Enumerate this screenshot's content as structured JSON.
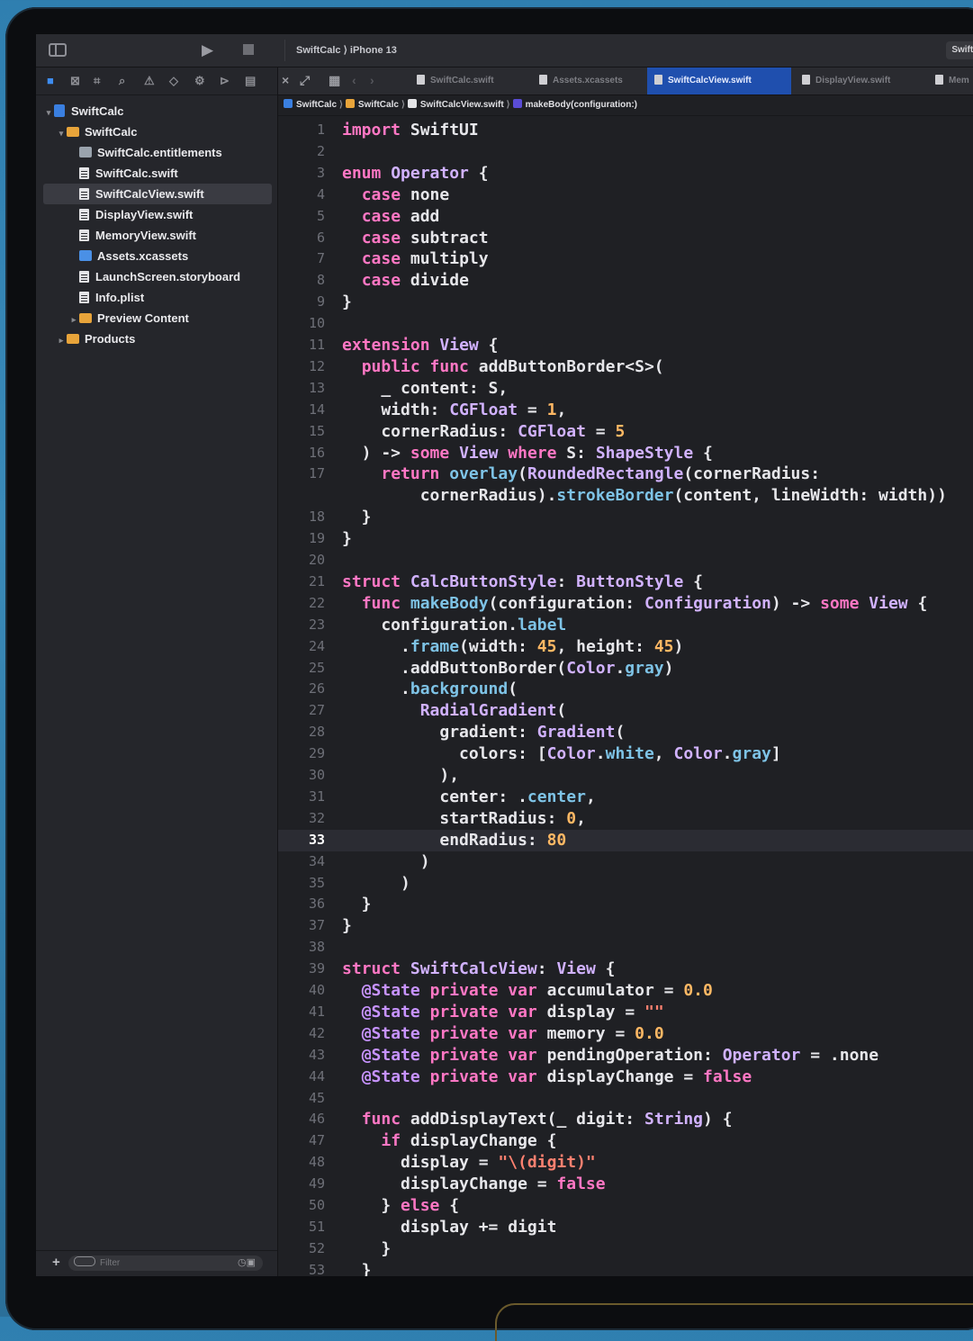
{
  "toolbar": {
    "scheme": "SwiftCalc ⟩ iPhone 13",
    "scheme_right": "SwiftCa",
    "run_icon": "play-icon",
    "stop_icon": "stop-icon"
  },
  "navigator": {
    "filter_placeholder": "Filter",
    "items": [
      {
        "label": "SwiftCalc",
        "kind": "project",
        "depth": 0,
        "disclosure": "▾"
      },
      {
        "label": "SwiftCalc",
        "kind": "folder",
        "depth": 1,
        "disclosure": "▾"
      },
      {
        "label": "SwiftCalc.entitlements",
        "kind": "entitlements",
        "depth": 2,
        "disclosure": ""
      },
      {
        "label": "SwiftCalc.swift",
        "kind": "file",
        "depth": 2,
        "disclosure": ""
      },
      {
        "label": "SwiftCalcView.swift",
        "kind": "file",
        "depth": 2,
        "disclosure": "",
        "selected": true
      },
      {
        "label": "DisplayView.swift",
        "kind": "file",
        "depth": 2,
        "disclosure": ""
      },
      {
        "label": "MemoryView.swift",
        "kind": "file",
        "depth": 2,
        "disclosure": ""
      },
      {
        "label": "Assets.xcassets",
        "kind": "assets",
        "depth": 2,
        "disclosure": ""
      },
      {
        "label": "LaunchScreen.storyboard",
        "kind": "file",
        "depth": 2,
        "disclosure": ""
      },
      {
        "label": "Info.plist",
        "kind": "file",
        "depth": 2,
        "disclosure": ""
      },
      {
        "label": "Preview Content",
        "kind": "folder",
        "depth": 2,
        "disclosure": "▸"
      },
      {
        "label": "Products",
        "kind": "folder",
        "depth": 1,
        "disclosure": "▸"
      }
    ]
  },
  "tabs": [
    {
      "label": "SwiftCalc.swift",
      "active": false
    },
    {
      "label": "Assets.xcassets",
      "active": false
    },
    {
      "label": "SwiftCalcView.swift",
      "active": true
    },
    {
      "label": "DisplayView.swift",
      "active": false
    },
    {
      "label": "Mem",
      "active": false
    }
  ],
  "jumpbar": {
    "project": "SwiftCalc",
    "folder": "SwiftCalc",
    "file": "SwiftCalcView.swift",
    "symbol": "makeBody(configuration:)"
  },
  "editor": {
    "current_line": 33,
    "lines": [
      {
        "n": "1",
        "tokens": [
          [
            "kw",
            "import"
          ],
          [
            "pl",
            " SwiftUI"
          ]
        ]
      },
      {
        "n": "2",
        "tokens": []
      },
      {
        "n": "3",
        "tokens": [
          [
            "kw",
            "enum"
          ],
          [
            "pl",
            " "
          ],
          [
            "ty",
            "Operator"
          ],
          [
            "pl",
            " {"
          ]
        ]
      },
      {
        "n": "4",
        "tokens": [
          [
            "pl",
            "  "
          ],
          [
            "kw",
            "case"
          ],
          [
            "pl",
            " none"
          ]
        ]
      },
      {
        "n": "5",
        "tokens": [
          [
            "pl",
            "  "
          ],
          [
            "kw",
            "case"
          ],
          [
            "pl",
            " add"
          ]
        ]
      },
      {
        "n": "6",
        "tokens": [
          [
            "pl",
            "  "
          ],
          [
            "kw",
            "case"
          ],
          [
            "pl",
            " subtract"
          ]
        ]
      },
      {
        "n": "7",
        "tokens": [
          [
            "pl",
            "  "
          ],
          [
            "kw",
            "case"
          ],
          [
            "pl",
            " multiply"
          ]
        ]
      },
      {
        "n": "8",
        "tokens": [
          [
            "pl",
            "  "
          ],
          [
            "kw",
            "case"
          ],
          [
            "pl",
            " divide"
          ]
        ]
      },
      {
        "n": "9",
        "tokens": [
          [
            "pl",
            "}"
          ]
        ]
      },
      {
        "n": "10",
        "tokens": []
      },
      {
        "n": "11",
        "tokens": [
          [
            "kw",
            "extension"
          ],
          [
            "pl",
            " "
          ],
          [
            "ty",
            "View"
          ],
          [
            "pl",
            " {"
          ]
        ]
      },
      {
        "n": "12",
        "tokens": [
          [
            "pl",
            "  "
          ],
          [
            "kw",
            "public func"
          ],
          [
            "pl",
            " addButtonBorder<S>("
          ]
        ]
      },
      {
        "n": "13",
        "tokens": [
          [
            "pl",
            "    _ content: S,"
          ]
        ]
      },
      {
        "n": "14",
        "tokens": [
          [
            "pl",
            "    width: "
          ],
          [
            "ty",
            "CGFloat"
          ],
          [
            "pl",
            " = "
          ],
          [
            "nb",
            "1"
          ],
          [
            "pl",
            ","
          ]
        ]
      },
      {
        "n": "15",
        "tokens": [
          [
            "pl",
            "    cornerRadius: "
          ],
          [
            "ty",
            "CGFloat"
          ],
          [
            "pl",
            " = "
          ],
          [
            "nb",
            "5"
          ]
        ]
      },
      {
        "n": "16",
        "tokens": [
          [
            "pl",
            "  ) -> "
          ],
          [
            "kw",
            "some"
          ],
          [
            "pl",
            " "
          ],
          [
            "ty",
            "View"
          ],
          [
            "pl",
            " "
          ],
          [
            "kw",
            "where"
          ],
          [
            "pl",
            " S: "
          ],
          [
            "ty",
            "ShapeStyle"
          ],
          [
            "pl",
            " {"
          ]
        ]
      },
      {
        "n": "17",
        "tokens": [
          [
            "pl",
            "    "
          ],
          [
            "kw",
            "return"
          ],
          [
            "pl",
            " "
          ],
          [
            "fn",
            "overlay"
          ],
          [
            "pl",
            "("
          ],
          [
            "ty",
            "RoundedRectangle"
          ],
          [
            "pl",
            "(cornerRadius:"
          ]
        ]
      },
      {
        "n": "",
        "tokens": [
          [
            "pl",
            "        cornerRadius)."
          ],
          [
            "fn",
            "strokeBorder"
          ],
          [
            "pl",
            "(content, lineWidth: width))"
          ]
        ]
      },
      {
        "n": "18",
        "tokens": [
          [
            "pl",
            "  }"
          ]
        ]
      },
      {
        "n": "19",
        "tokens": [
          [
            "pl",
            "}"
          ]
        ]
      },
      {
        "n": "20",
        "tokens": []
      },
      {
        "n": "21",
        "tokens": [
          [
            "kw",
            "struct"
          ],
          [
            "pl",
            " "
          ],
          [
            "ty",
            "CalcButtonStyle"
          ],
          [
            "pl",
            ": "
          ],
          [
            "ty",
            "ButtonStyle"
          ],
          [
            "pl",
            " {"
          ]
        ]
      },
      {
        "n": "22",
        "tokens": [
          [
            "pl",
            "  "
          ],
          [
            "kw",
            "func"
          ],
          [
            "pl",
            " "
          ],
          [
            "fn",
            "makeBody"
          ],
          [
            "pl",
            "(configuration: "
          ],
          [
            "ty",
            "Configuration"
          ],
          [
            "pl",
            ") -> "
          ],
          [
            "kw",
            "some"
          ],
          [
            "pl",
            " "
          ],
          [
            "ty",
            "View"
          ],
          [
            "pl",
            " {"
          ]
        ]
      },
      {
        "n": "23",
        "tokens": [
          [
            "pl",
            "    configuration."
          ],
          [
            "fn",
            "label"
          ]
        ]
      },
      {
        "n": "24",
        "tokens": [
          [
            "pl",
            "      ."
          ],
          [
            "fn",
            "frame"
          ],
          [
            "pl",
            "(width: "
          ],
          [
            "nb",
            "45"
          ],
          [
            "pl",
            ", height: "
          ],
          [
            "nb",
            "45"
          ],
          [
            "pl",
            ")"
          ]
        ]
      },
      {
        "n": "25",
        "tokens": [
          [
            "pl",
            "      .addButtonBorder("
          ],
          [
            "ty",
            "Color"
          ],
          [
            "pl",
            "."
          ],
          [
            "fn",
            "gray"
          ],
          [
            "pl",
            ")"
          ]
        ]
      },
      {
        "n": "26",
        "tokens": [
          [
            "pl",
            "      ."
          ],
          [
            "fn",
            "background"
          ],
          [
            "pl",
            "("
          ]
        ]
      },
      {
        "n": "27",
        "tokens": [
          [
            "pl",
            "        "
          ],
          [
            "ty",
            "RadialGradient"
          ],
          [
            "pl",
            "("
          ]
        ]
      },
      {
        "n": "28",
        "tokens": [
          [
            "pl",
            "          gradient: "
          ],
          [
            "ty",
            "Gradient"
          ],
          [
            "pl",
            "("
          ]
        ]
      },
      {
        "n": "29",
        "tokens": [
          [
            "pl",
            "            colors: ["
          ],
          [
            "ty",
            "Color"
          ],
          [
            "pl",
            "."
          ],
          [
            "fn",
            "white"
          ],
          [
            "pl",
            ", "
          ],
          [
            "ty",
            "Color"
          ],
          [
            "pl",
            "."
          ],
          [
            "fn",
            "gray"
          ],
          [
            "pl",
            "]"
          ]
        ]
      },
      {
        "n": "30",
        "tokens": [
          [
            "pl",
            "          ),"
          ]
        ]
      },
      {
        "n": "31",
        "tokens": [
          [
            "pl",
            "          center: ."
          ],
          [
            "fn",
            "center"
          ],
          [
            "pl",
            ","
          ]
        ]
      },
      {
        "n": "32",
        "tokens": [
          [
            "pl",
            "          startRadius: "
          ],
          [
            "nb",
            "0"
          ],
          [
            "pl",
            ","
          ]
        ]
      },
      {
        "n": "33",
        "tokens": [
          [
            "pl",
            "          endRadius: "
          ],
          [
            "nb",
            "80"
          ]
        ]
      },
      {
        "n": "34",
        "tokens": [
          [
            "pl",
            "        )"
          ]
        ]
      },
      {
        "n": "35",
        "tokens": [
          [
            "pl",
            "      )"
          ]
        ]
      },
      {
        "n": "36",
        "tokens": [
          [
            "pl",
            "  }"
          ]
        ]
      },
      {
        "n": "37",
        "tokens": [
          [
            "pl",
            "}"
          ]
        ]
      },
      {
        "n": "38",
        "tokens": []
      },
      {
        "n": "39",
        "tokens": [
          [
            "kw",
            "struct"
          ],
          [
            "pl",
            " "
          ],
          [
            "ty",
            "SwiftCalcView"
          ],
          [
            "pl",
            ": "
          ],
          [
            "ty",
            "View"
          ],
          [
            "pl",
            " {"
          ]
        ]
      },
      {
        "n": "40",
        "tokens": [
          [
            "pl",
            "  "
          ],
          [
            "at",
            "@State"
          ],
          [
            "pl",
            " "
          ],
          [
            "kw",
            "private var"
          ],
          [
            "pl",
            " accumulator = "
          ],
          [
            "nb",
            "0.0"
          ]
        ]
      },
      {
        "n": "41",
        "tokens": [
          [
            "pl",
            "  "
          ],
          [
            "at",
            "@State"
          ],
          [
            "pl",
            " "
          ],
          [
            "kw",
            "private var"
          ],
          [
            "pl",
            " display = "
          ],
          [
            "st",
            "\"\""
          ]
        ]
      },
      {
        "n": "42",
        "tokens": [
          [
            "pl",
            "  "
          ],
          [
            "at",
            "@State"
          ],
          [
            "pl",
            " "
          ],
          [
            "kw",
            "private var"
          ],
          [
            "pl",
            " memory = "
          ],
          [
            "nb",
            "0.0"
          ]
        ]
      },
      {
        "n": "43",
        "tokens": [
          [
            "pl",
            "  "
          ],
          [
            "at",
            "@State"
          ],
          [
            "pl",
            " "
          ],
          [
            "kw",
            "private var"
          ],
          [
            "pl",
            " pendingOperation: "
          ],
          [
            "ty",
            "Operator"
          ],
          [
            "pl",
            " = .none"
          ]
        ]
      },
      {
        "n": "44",
        "tokens": [
          [
            "pl",
            "  "
          ],
          [
            "at",
            "@State"
          ],
          [
            "pl",
            " "
          ],
          [
            "kw",
            "private var"
          ],
          [
            "pl",
            " displayChange = "
          ],
          [
            "kw",
            "false"
          ]
        ]
      },
      {
        "n": "45",
        "tokens": []
      },
      {
        "n": "46",
        "tokens": [
          [
            "pl",
            "  "
          ],
          [
            "kw",
            "func"
          ],
          [
            "pl",
            " addDisplayText(_ digit: "
          ],
          [
            "ty",
            "String"
          ],
          [
            "pl",
            ") {"
          ]
        ]
      },
      {
        "n": "47",
        "tokens": [
          [
            "pl",
            "    "
          ],
          [
            "kw",
            "if"
          ],
          [
            "pl",
            " displayChange {"
          ]
        ]
      },
      {
        "n": "48",
        "tokens": [
          [
            "pl",
            "      display = "
          ],
          [
            "st",
            "\"\\(digit)\""
          ]
        ]
      },
      {
        "n": "49",
        "tokens": [
          [
            "pl",
            "      displayChange = "
          ],
          [
            "kw",
            "false"
          ]
        ]
      },
      {
        "n": "50",
        "tokens": [
          [
            "pl",
            "    } "
          ],
          [
            "kw",
            "else"
          ],
          [
            "pl",
            " {"
          ]
        ]
      },
      {
        "n": "51",
        "tokens": [
          [
            "pl",
            "      display += digit"
          ]
        ]
      },
      {
        "n": "52",
        "tokens": [
          [
            "pl",
            "    }"
          ]
        ]
      },
      {
        "n": "53",
        "tokens": [
          [
            "pl",
            "  }"
          ]
        ]
      }
    ]
  },
  "colors": {
    "keyword": "#ff77c4",
    "type": "#d1b2ff",
    "number": "#ffb864",
    "string": "#ff8170",
    "function": "#7ec3e6",
    "accent": "#1f4fae"
  }
}
